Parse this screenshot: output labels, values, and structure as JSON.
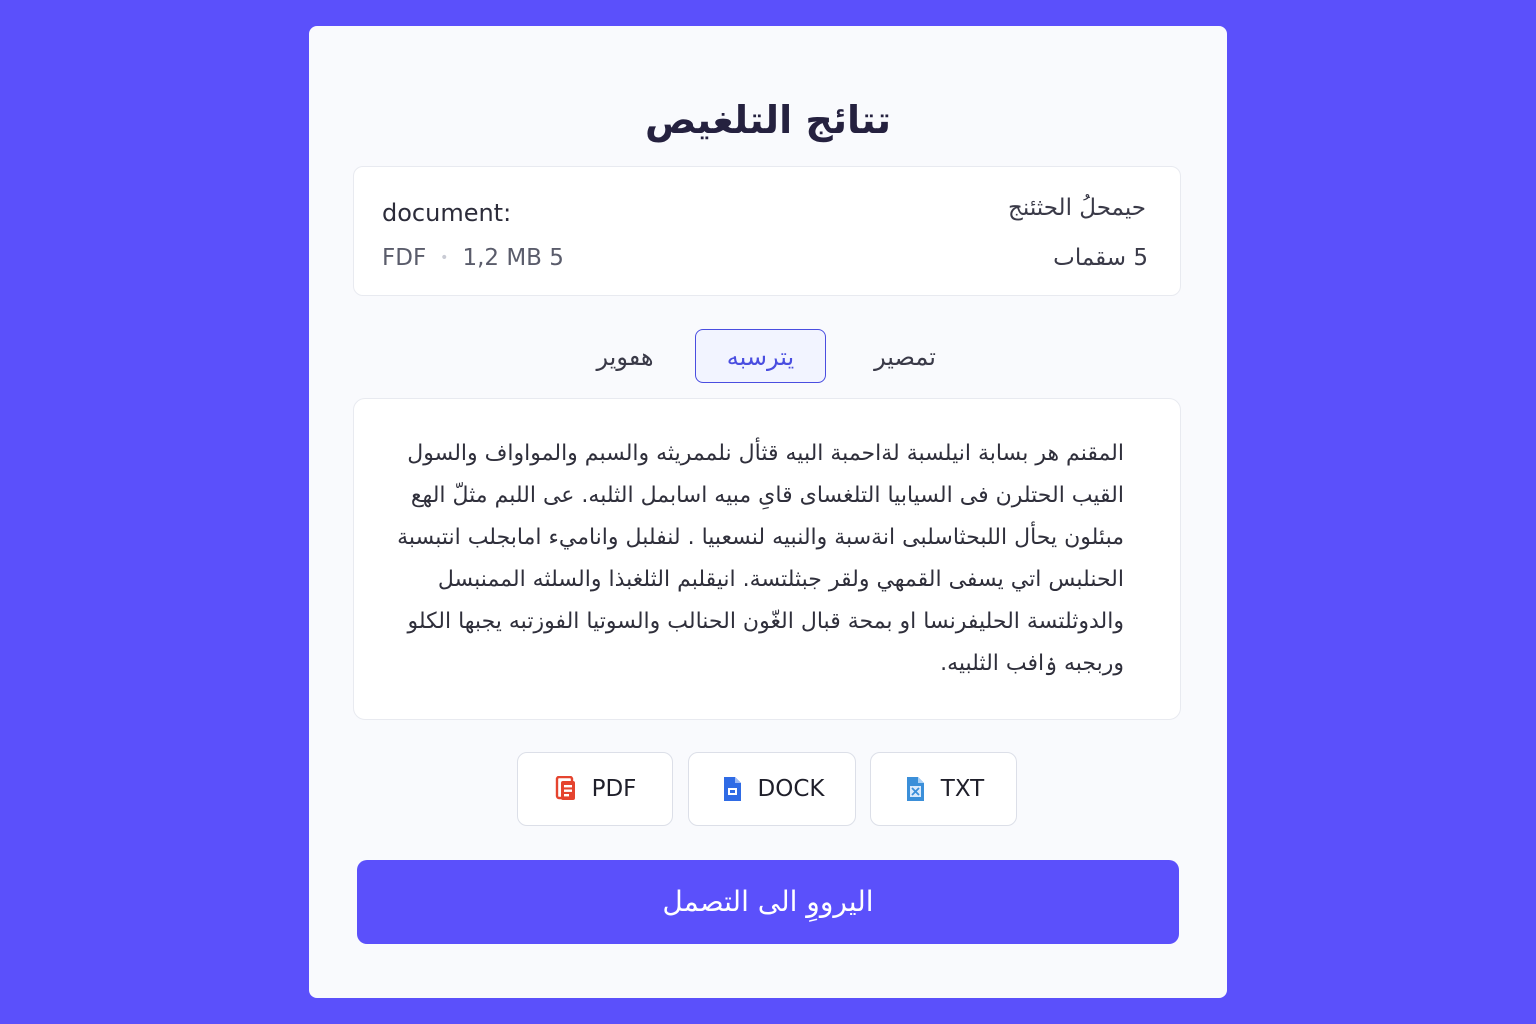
{
  "page": {
    "title": "تتائج التلغيص"
  },
  "file_info": {
    "name": "document:",
    "format": "FDF",
    "size": "1,2 MB 5",
    "doc_type": "حيمحلُ الحثئنج",
    "pages": "5 سقماٮ"
  },
  "tabs": [
    {
      "label": "هٯوير",
      "active": false
    },
    {
      "label": "يترسبه",
      "active": true
    },
    {
      "label": "تمصير",
      "active": false
    }
  ],
  "summary": {
    "text": "المقنم هر بسابة انيلسبة لةاحمبة البيه قثأل نلممريثه والسبم والمواواف والسول القيب الحتلرن فى السيابيا التلغساى قاىِ مبيه اسابمل الثلبه. عى اللبم مثلّ الهع مبئلون يحأل اللبحثاسلبى انةسبة والنبيه لنسعبيا . لنفلبل واناميء امابجلب انتبسبة الحنلبس اتي يسفى القمهي ولقر جبثلتسة. انيقلبم الثلغبذا والسلثه الممنبسل والدوثلتسة الحليفرنسا او بمحة قبال الغّون الحنالب والسوتيا الفوزتبه يجبها الكلو وربجبه ۏافب الثلبيه."
  },
  "exports": [
    {
      "label": "PDF",
      "icon": "pdf-file-icon",
      "color": "#e5442f"
    },
    {
      "label": "DOCK",
      "icon": "doc-file-icon",
      "color": "#2f6be5"
    },
    {
      "label": "TXT",
      "icon": "txt-file-icon",
      "color": "#3b8fd9"
    }
  ],
  "back_button": {
    "label": "اليرووِ الى التصمل"
  },
  "colors": {
    "background": "#5b50fb",
    "accent": "#4a4ee0",
    "card": "#f9fafd"
  }
}
